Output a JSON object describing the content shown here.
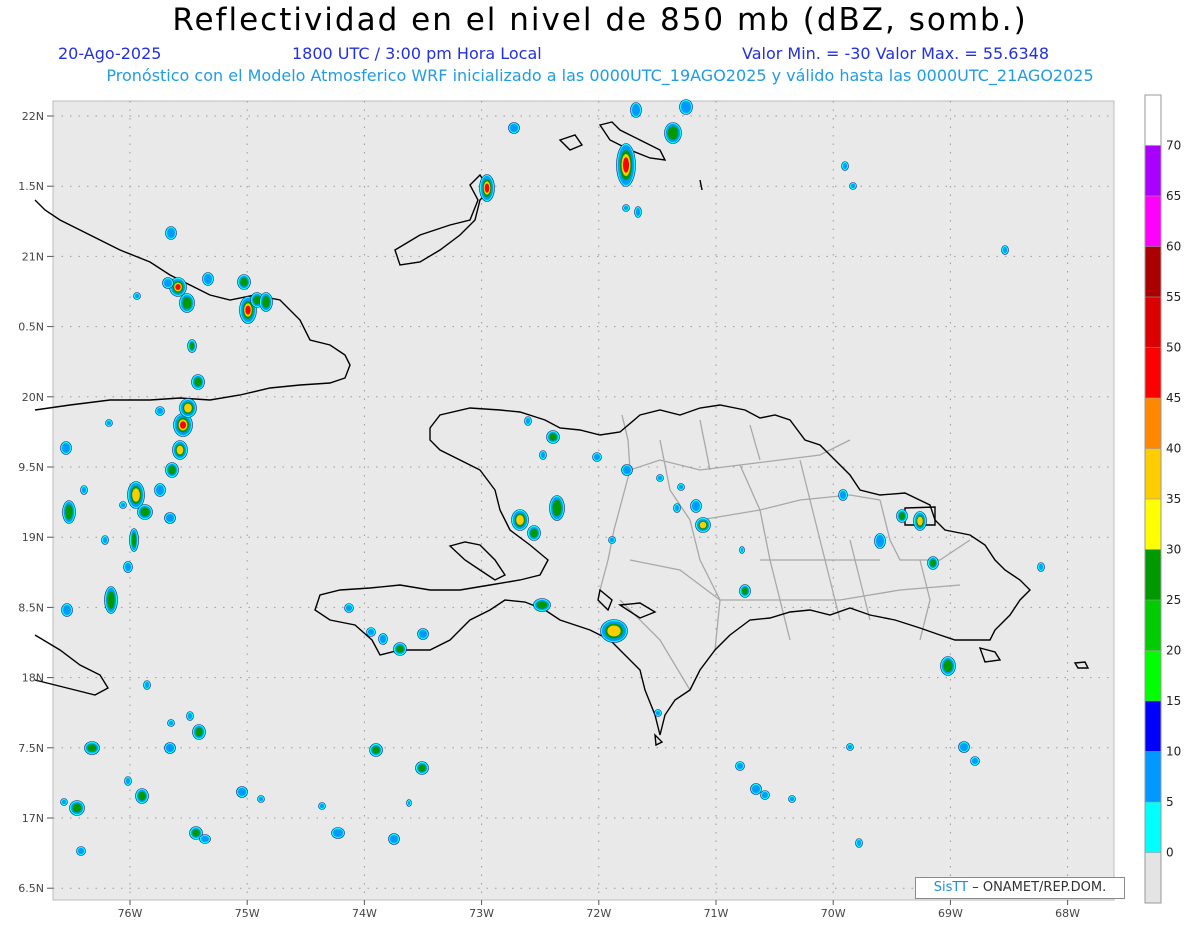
{
  "header": {
    "title": "Reflectividad en el nivel de 850 mb (dBZ, somb.)",
    "date": "20-Ago-2025",
    "time": "1800 UTC / 3:00 pm Hora Local",
    "minmax": "Valor Min. = -30  Valor Max. = 55.6348",
    "model_info": "Pronóstico con el Modelo Atmosferico WRF inicializado a las 0000UTC_19AGO2025 y válido hasta las  0000UTC_21AGO2025"
  },
  "axes": {
    "lat_labels": [
      "22N",
      "1.5N",
      "21N",
      "0.5N",
      "20N",
      "9.5N",
      "19N",
      "8.5N",
      "18N",
      "7.5N",
      "17N",
      "6.5N"
    ],
    "lon_labels": [
      "76W",
      "75W",
      "74W",
      "73W",
      "72W",
      "71W",
      "70W",
      "69W",
      "68W"
    ]
  },
  "colorbar": {
    "labels": [
      "0",
      "5",
      "10",
      "15",
      "20",
      "25",
      "30",
      "35",
      "40",
      "45",
      "50",
      "55",
      "60",
      "65",
      "70"
    ],
    "colors": [
      "#e4e4e4",
      "#00ffff",
      "#0099ff",
      "#0000ff",
      "#00ff00",
      "#00cc00",
      "#009900",
      "#ffff00",
      "#ffcc00",
      "#ff8800",
      "#ff0000",
      "#dd0000",
      "#aa0000",
      "#ff00ff",
      "#aa00ff",
      "#ffffff"
    ]
  },
  "credit": {
    "logo": "SisTT",
    "text": "– ONAMET/REP.DOM."
  },
  "colors": {
    "background": "#e9e9e9",
    "coast": "#000000",
    "provinces": "#a8a8a8",
    "title_blue": "#2230e0",
    "info_cyan": "#1f9ce6"
  }
}
